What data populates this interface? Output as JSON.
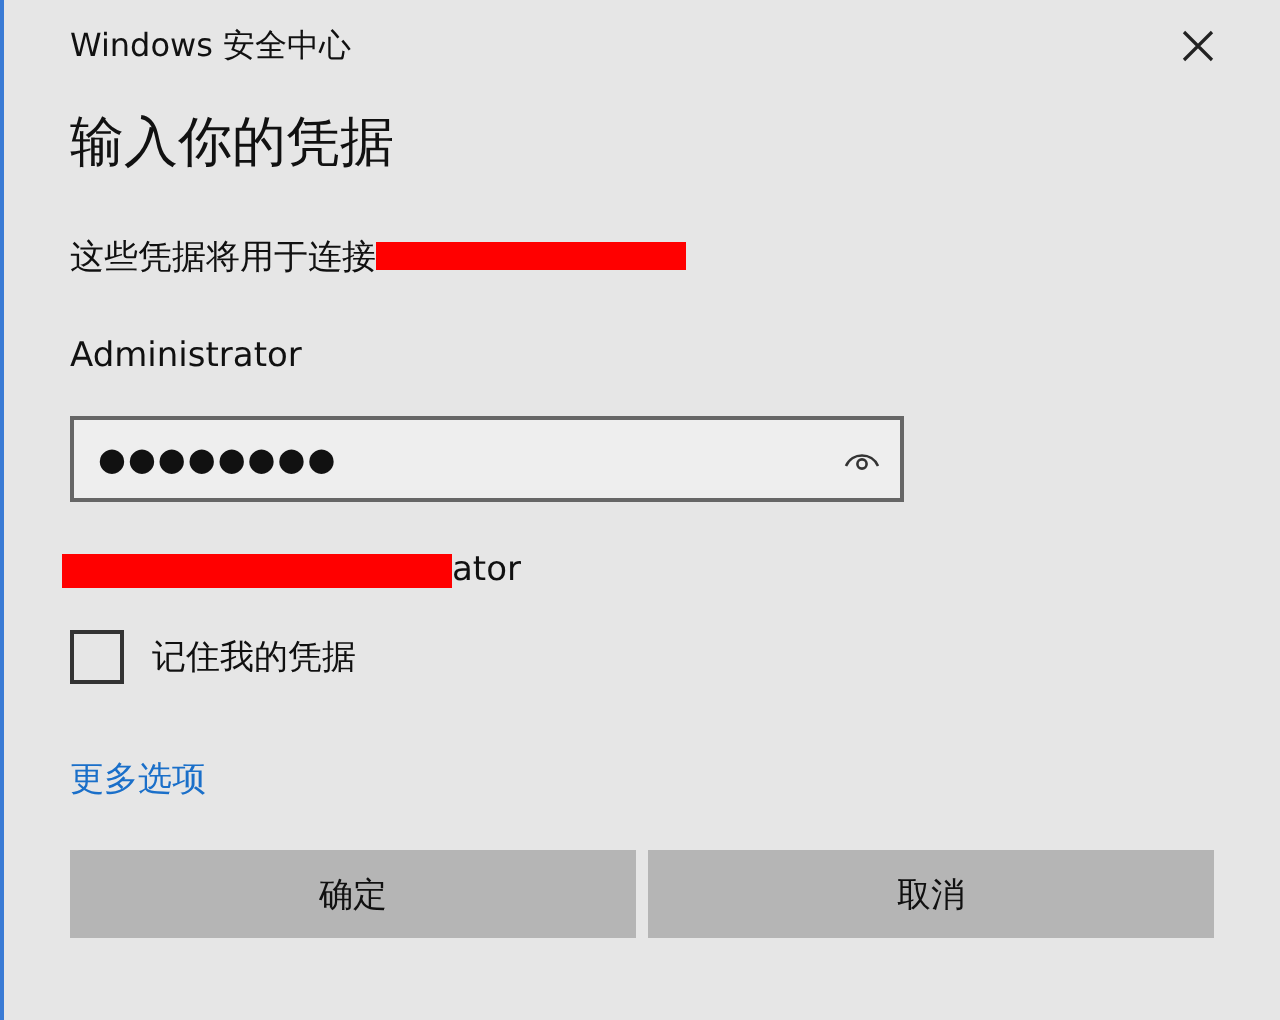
{
  "window": {
    "title": "Windows 安全中心"
  },
  "heading": "输入你的凭据",
  "connect_text": "这些凭据将用于连接",
  "username": "Administrator",
  "password": {
    "value": "●●●●●●●●"
  },
  "domain_user_tail": "ator",
  "remember": {
    "label": "记住我的凭据",
    "checked": false
  },
  "more_options": "更多选项",
  "buttons": [
    {
      "label": "确定"
    },
    {
      "label": "取消"
    }
  ]
}
